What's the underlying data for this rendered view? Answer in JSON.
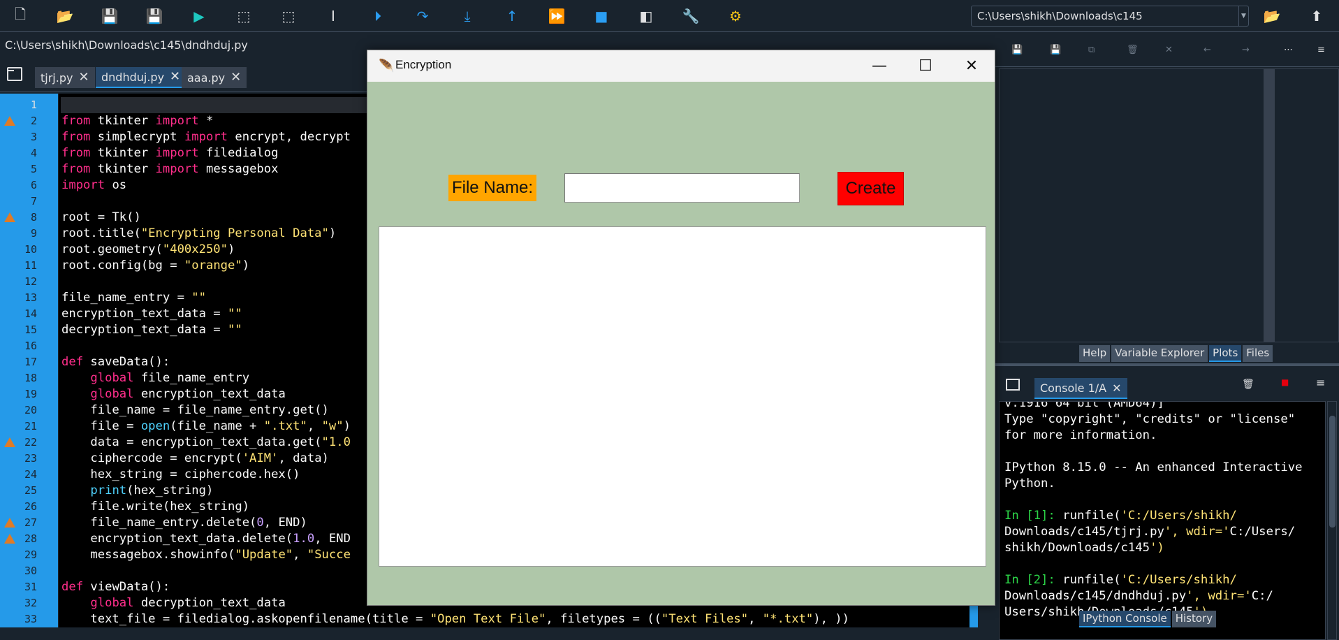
{
  "toolbar": {
    "icons": [
      "new-file-icon",
      "open-file-icon",
      "save-icon",
      "save-all-icon",
      "run-icon",
      "run-cell-icon",
      "run-cell-advance-icon",
      "run-selection-icon",
      "debug-icon",
      "step-icon",
      "step-into-icon",
      "step-return-icon",
      "continue-icon",
      "stop-icon",
      "maximize-pane-icon",
      "preferences-icon",
      "python-path-icon"
    ],
    "working_dir": "C:\\Users\\shikh\\Downloads\\c145"
  },
  "editor": {
    "file_path": "C:\\Users\\shikh\\Downloads\\c145\\dndhduj.py",
    "tabs": [
      {
        "label": "tjrj.py"
      },
      {
        "label": "dndhduj.py"
      },
      {
        "label": "aaa.py"
      }
    ],
    "line_numbers": [
      "1",
      "2",
      "3",
      "4",
      "5",
      "6",
      "7",
      "8",
      "9",
      "10",
      "11",
      "12",
      "13",
      "14",
      "15",
      "16",
      "17",
      "18",
      "19",
      "20",
      "21",
      "22",
      "23",
      "24",
      "25",
      "26",
      "27",
      "28",
      "29",
      "30",
      "31",
      "32",
      "33"
    ],
    "warning_lines": [
      2,
      8,
      22,
      27,
      28
    ],
    "lines": [
      "",
      "from tkinter import *",
      "from simplecrypt import encrypt, decrypt",
      "from tkinter import filedialog",
      "from tkinter import messagebox",
      "import os",
      "",
      "root = Tk()",
      "root.title(\"Encrypting Personal Data\")",
      "root.geometry(\"400x250\")",
      "root.config(bg = \"orange\")",
      "",
      "file_name_entry = \"\"",
      "encryption_text_data = \"\"",
      "decryption_text_data = \"\"",
      "",
      "def saveData():",
      "    global file_name_entry",
      "    global encryption_text_data",
      "    file_name = file_name_entry.get()",
      "    file = open(file_name + \".txt\", \"w\")",
      "    data = encryption_text_data.get(\"1.0",
      "    ciphercode = encrypt('AIM', data)",
      "    hex_string = ciphercode.hex()",
      "    print(hex_string)",
      "    file.write(hex_string)",
      "    file_name_entry.delete(0, END)",
      "    encryption_text_data.delete(1.0, END",
      "    messagebox.showinfo(\"Update\", \"Succe",
      "",
      "def viewData():",
      "    global decryption_text_data",
      "    text_file = filedialog.askopenfilename(title = \"Open Text File\", filetypes = ((\"Text Files\", \"*.txt\"), ))"
    ]
  },
  "right_pane": {
    "tabs": [
      "Help",
      "Variable Explorer",
      "Plots",
      "Files"
    ],
    "active_tab": "Plots",
    "console_tab": "Console 1/A",
    "console_lines": [
      "v.1916 64 bit (AMD64)]",
      "Type \"copyright\", \"credits\" or \"license\"",
      "for more information.",
      "",
      "IPython 8.15.0 -- An enhanced Interactive",
      "Python.",
      "",
      "In [1]: runfile('C:/Users/shikh/",
      "Downloads/c145/tjrj.py', wdir='C:/Users/",
      "shikh/Downloads/c145')",
      "",
      "In [2]: runfile('C:/Users/shikh/",
      "Downloads/c145/dndhduj.py', wdir='C:/",
      "Users/shikh/Downloads/c145')"
    ],
    "bottom_tabs": [
      "IPython Console",
      "History"
    ]
  },
  "tk_window": {
    "title": "Encryption",
    "label_text": "File Name:",
    "entry_value": "",
    "button_text": "Create",
    "bg_color": "#afc7a9",
    "label_bg": "#ffa500",
    "button_bg": "#ff0000"
  }
}
